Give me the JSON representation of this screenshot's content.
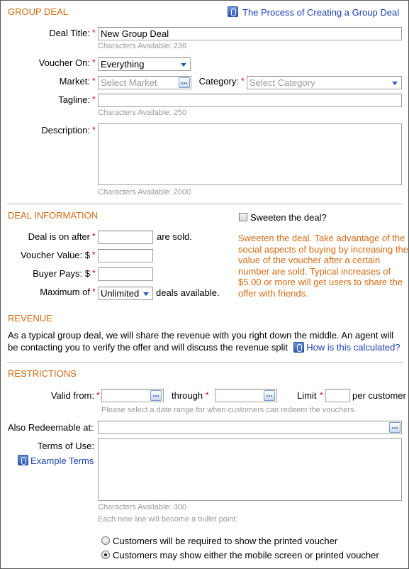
{
  "group_deal": {
    "title": "GROUP DEAL",
    "process_link": "The Process of Creating a Group Deal",
    "deal_title_label": "Deal Title:",
    "deal_title_value": "New Group Deal",
    "deal_title_hint": "Characters Available: 236",
    "voucher_on_label": "Voucher On:",
    "voucher_on_value": "Everything",
    "market_label": "Market:",
    "market_placeholder": "Select Market",
    "category_label": "Category:",
    "category_placeholder": "Select Category",
    "tagline_label": "Tagline:",
    "tagline_hint": "Characters Available: 250",
    "description_label": "Description:",
    "description_hint": "Characters Available: 2000",
    "required_mark": "*",
    "dots": "..."
  },
  "deal_information": {
    "title": "DEAL INFORMATION",
    "deal_on_after_label": "Deal is on after",
    "are_sold": "are sold.",
    "voucher_value_label": "Voucher Value: $",
    "buyer_pays_label": "Buyer Pays: $",
    "maximum_of_label": "Maximum of",
    "maximum_value": "Unlimited",
    "deals_available": "deals available.",
    "sweeten_label": "Sweeten the deal?",
    "sweeten_checked": false,
    "sweeten_text": "Sweeten the deal. Take advantage of the social aspects of buying by increasing the value of the voucher after a certain number are sold. Typical increases of $5.00 or more will get users to share the offer with friends."
  },
  "revenue": {
    "title": "REVENUE",
    "text": "As a typical group deal, we will share the revenue with you right down the middle. An agent will be contacting you to verify the offer and will discuss the revenue split",
    "link": "How is this calculated?"
  },
  "restrictions": {
    "title": "RESTRICTIONS",
    "valid_from_label": "Valid from:",
    "through_label": "through",
    "limit_label": "Limit",
    "per_customer": "per customer",
    "date_hint": "Please select a date range for when customers can redeem the vouchers.",
    "also_redeemable_label": "Also Redeemable at:",
    "terms_label": "Terms of Use:",
    "example_terms_link": "Example Terms",
    "terms_hint1": "Characters Available: 300",
    "terms_hint2": "Each new line will become a bullet point.",
    "radio_printed": "Customers will be required to show the printed voucher",
    "radio_mobile": "Customers may show either the mobile screen or printed voucher",
    "selected_option": "mobile"
  },
  "colors": {
    "section": "#d46a12",
    "required": "#d40000",
    "link": "#1a3fae",
    "hint": "#999999"
  }
}
